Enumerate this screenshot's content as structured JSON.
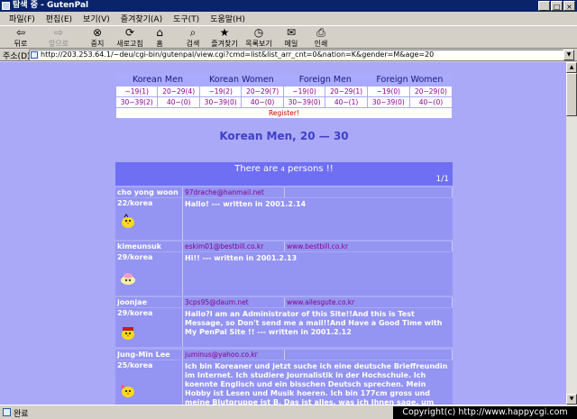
{
  "window": {
    "title": "탐색 중 - GutenPal",
    "controls": {
      "minimize": "_",
      "maximize": "□",
      "close": "×"
    }
  },
  "menu": [
    "파일(F)",
    "편집(E)",
    "보기(V)",
    "즐겨찾기(A)",
    "도구(T)",
    "도움말(H)"
  ],
  "toolbar": {
    "back": "뒤로",
    "forward": "앞으로",
    "stop": "중지",
    "refresh": "새로고침",
    "home": "홈",
    "search": "검색",
    "favorites": "즐겨찾기",
    "history": "목록보기",
    "mail": "메일",
    "print": "인쇄"
  },
  "address": {
    "label": "주소(D)",
    "value": "http://203.253.64.1/~deu/cgi-bin/gutenpal/view.cgi?cmd=list&list_arr_cnt=0&nation=K&gender=M&age=20"
  },
  "categories": {
    "groups": [
      "Korean Men",
      "Korean Women",
      "Foreign Men",
      "Foreign Women"
    ],
    "row1": [
      "~19(1)",
      "20~29(4)",
      "~19(2)",
      "20~29(7)",
      "~19(0)",
      "20~29(1)",
      "~19(0)",
      "20~29(0)"
    ],
    "row2": [
      "30~39(2)",
      "40~(0)",
      "30~39(0)",
      "40~(0)",
      "30~39(0)",
      "40~(1)",
      "30~39(0)",
      "40~(0)"
    ],
    "register": "Register!"
  },
  "page_title": "Korean Men, 20 — 30",
  "banner": {
    "pre": "There are ",
    "count": "4",
    "post": " persons !!",
    "page": "1/1"
  },
  "entries": [
    {
      "name": "cho yong woon",
      "email": "97drache@hanmail.net",
      "homepage": "",
      "age_nation": "22/korea",
      "message": "Hallo! --- written in 2001.2.14"
    },
    {
      "name": "kimeunsuk",
      "email": "eskim01@bestbill.co.kr",
      "homepage": "www.bestbill.co.kr",
      "age_nation": "29/korea",
      "message": "Hi!! --- written in 2001.2.13"
    },
    {
      "name": "joonjae",
      "email": "3cps95@daum.net",
      "homepage": "www.ailesgute.co.kr",
      "age_nation": "29/korea",
      "message": "Hallo?I am an Administrator of this Site!!And this is Test Message, so Don't send me a mail!!And Have a Good Time with My PenPal Site !! --- written in 2001.2.12"
    },
    {
      "name": "Jung-Min Lee",
      "email": "juminus@yahoo.co.kr",
      "homepage": "",
      "age_nation": "25/korea",
      "message": "Ich bin Koreaner und jetzt suche ich eine deutsche Brieffreundin im Internet. Ich studiere Journalistik in der Hochschule. Ich koennte Englisch und ein bisschen Deutsch sprechen. Mein Hobby ist Lesen und Musik hoeren. Ich bin 177cm gross und meine Blutgruppe ist B. Das ist alles, was ich Ihnen sage, um"
    }
  ],
  "status": {
    "text": "완료"
  },
  "watermark": "Copyright(c) http://www.happycgi.com"
}
